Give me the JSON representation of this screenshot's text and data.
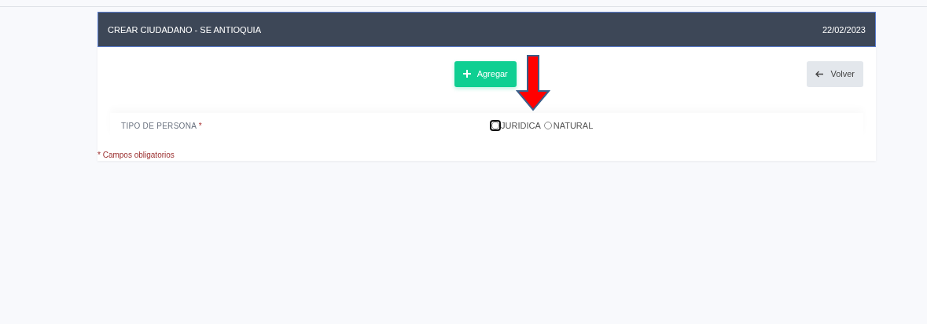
{
  "header": {
    "title": "CREAR CIUDADANO - SE ANTIOQUIA",
    "date": "22/02/2023"
  },
  "buttons": {
    "add": "Agregar",
    "back": "Volver"
  },
  "field": {
    "label": "TIPO DE PERSONA",
    "required_mark": "*",
    "options": [
      {
        "label": "JURIDICA",
        "selected": false,
        "focused": true
      },
      {
        "label": "NATURAL",
        "selected": false,
        "focused": false
      }
    ]
  },
  "footnote": "* Campos obligatorios"
}
